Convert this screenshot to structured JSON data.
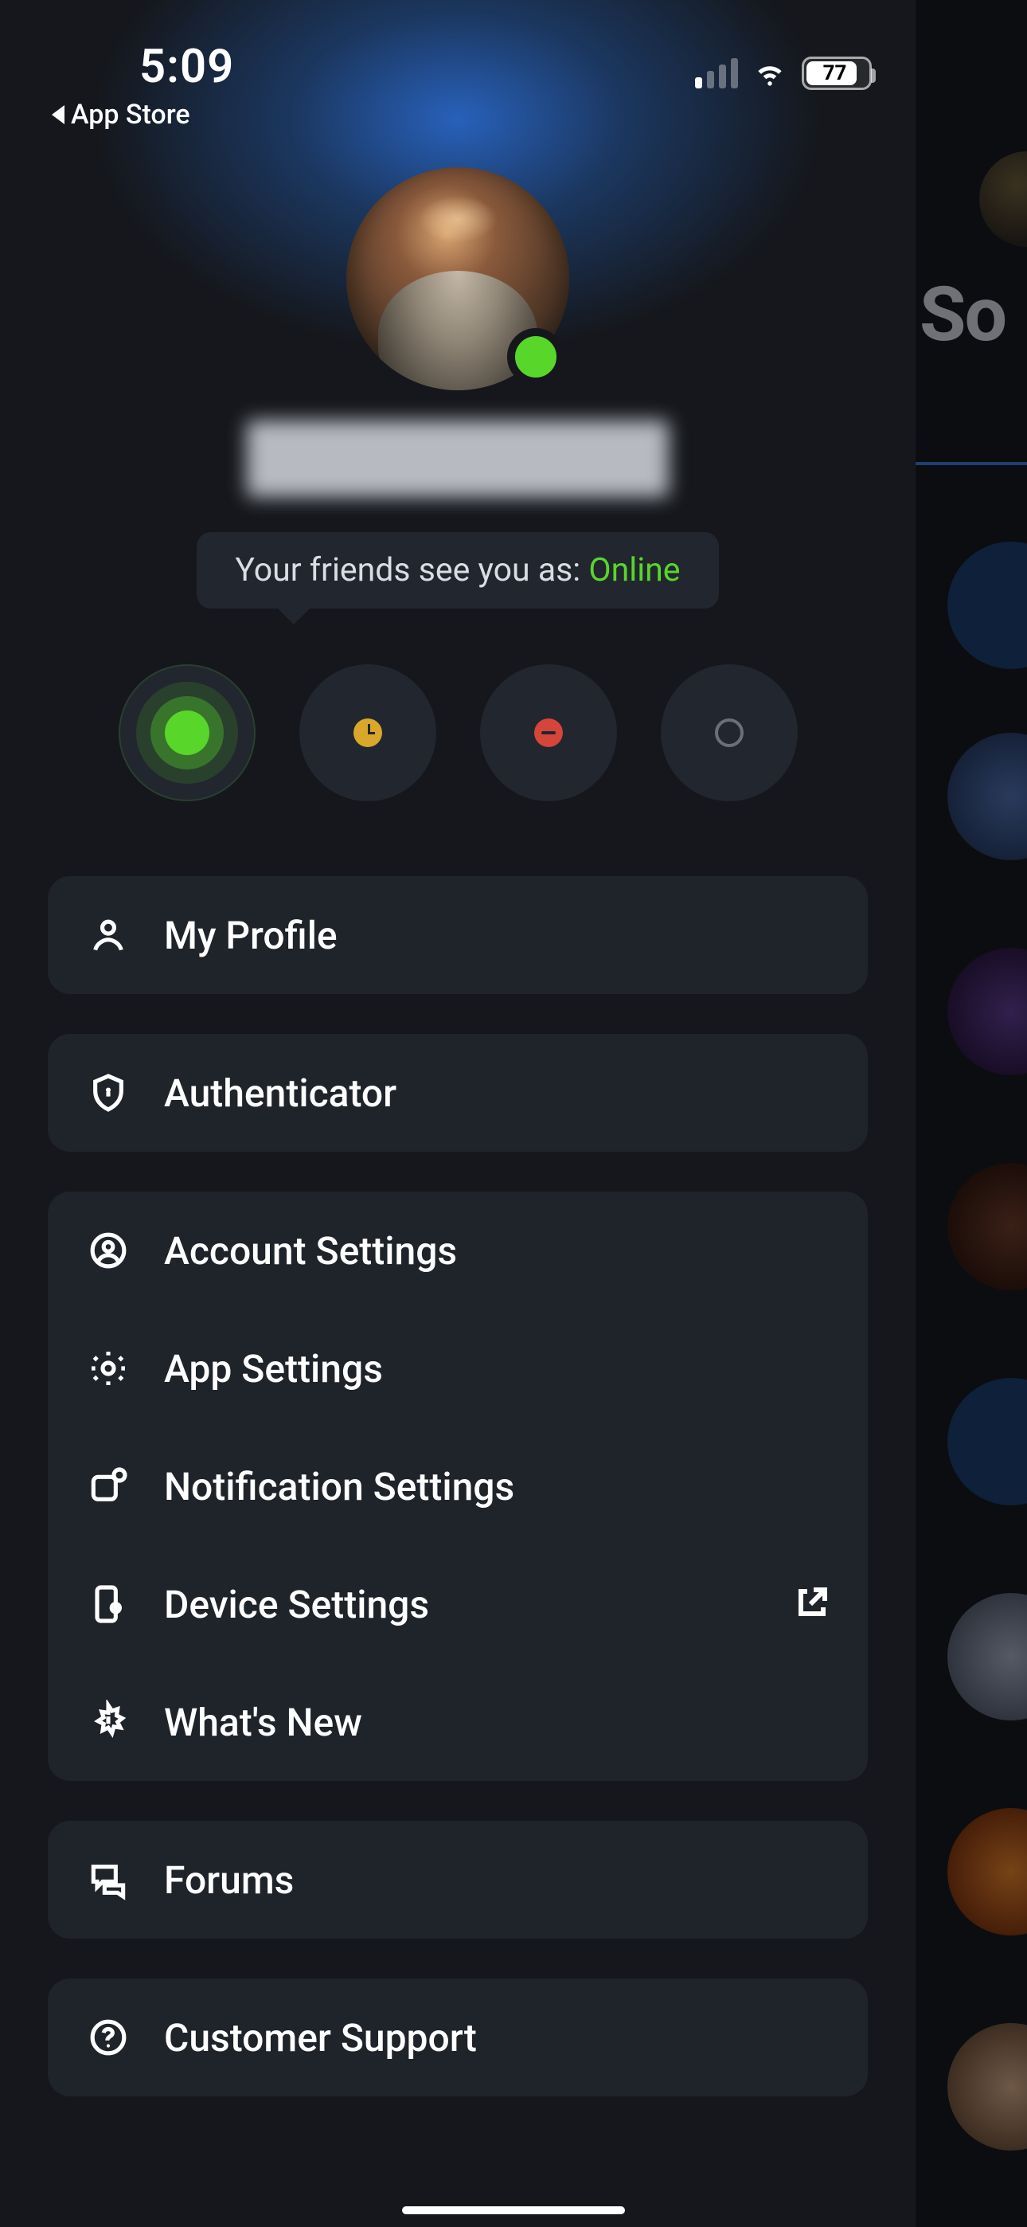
{
  "status_bar": {
    "time": "5:09",
    "back_label": "App Store",
    "battery_pct": "77"
  },
  "profile": {
    "status_text": "Your friends see you as: ",
    "status_value": "Online"
  },
  "presence_options": [
    "online",
    "away",
    "busy",
    "offline"
  ],
  "peek": {
    "title": "So"
  },
  "menu": {
    "my_profile": "My Profile",
    "authenticator": "Authenticator",
    "account_settings": "Account Settings",
    "app_settings": "App Settings",
    "notification_settings": "Notification Settings",
    "device_settings": "Device Settings",
    "whats_new": "What's New",
    "forums": "Forums",
    "customer_support": "Customer Support"
  }
}
